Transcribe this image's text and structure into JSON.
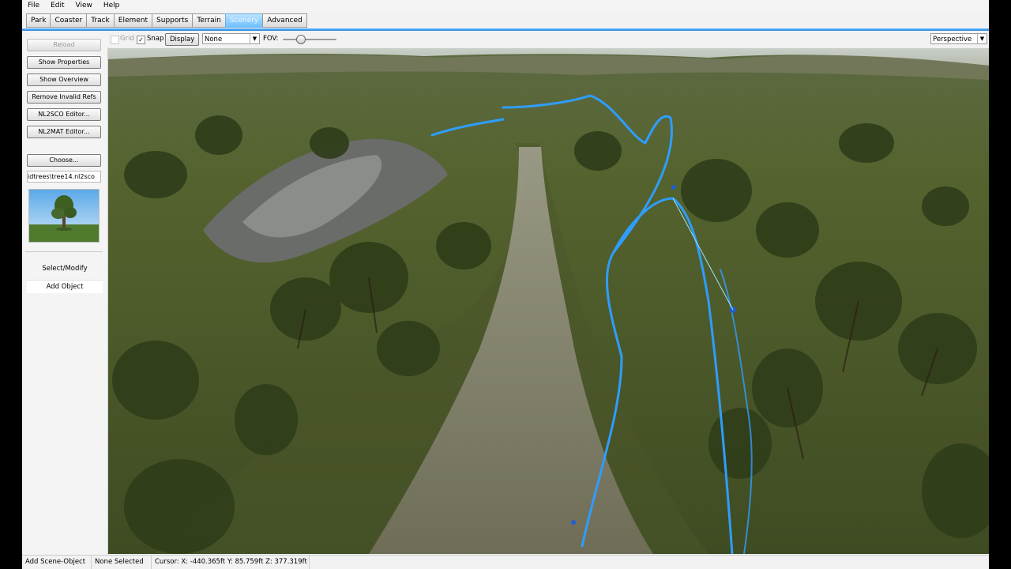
{
  "menu": [
    "File",
    "Edit",
    "View",
    "Help"
  ],
  "tabs": [
    {
      "label": "Park",
      "active": false
    },
    {
      "label": "Coaster",
      "active": false
    },
    {
      "label": "Track",
      "active": false
    },
    {
      "label": "Element",
      "active": false
    },
    {
      "label": "Supports",
      "active": false
    },
    {
      "label": "Terrain",
      "active": false
    },
    {
      "label": "Scenery",
      "active": true
    },
    {
      "label": "Advanced",
      "active": false
    }
  ],
  "sidebar": {
    "reload": "Reload",
    "show_properties": "Show Properties",
    "show_overview": "Show Overview",
    "remove_invalid_refs": "Remove Invalid Refs",
    "nl2sco_editor": "NL2SCO Editor...",
    "nl2mat_editor": "NL2MAT Editor...",
    "choose": "Choose...",
    "file_path": "idtrees\\tree14.nl2sco",
    "preview_icon": "tree-preview-thumbnail",
    "select_modify": "Select/Modify",
    "add_object": "Add Object"
  },
  "toolbar": {
    "grid_label": "Grid",
    "grid_checked": false,
    "snap_label": "Snap",
    "snap_checked": true,
    "display_button": "Display",
    "display_select": "None",
    "fov_label": "FOV:",
    "fov_level": 0.3,
    "projection_select": "Perspective"
  },
  "statusbar": {
    "mode": "Add Scene-Object",
    "selection": "None Selected",
    "cursor": "Cursor: X: -440.365ft Y: 85.759ft Z: 377.319ft"
  },
  "colors": {
    "active_tab": "#6cc0ff",
    "track": "#2f9dff",
    "grass": "#4f5e2c",
    "path": "#8e8a7c"
  }
}
